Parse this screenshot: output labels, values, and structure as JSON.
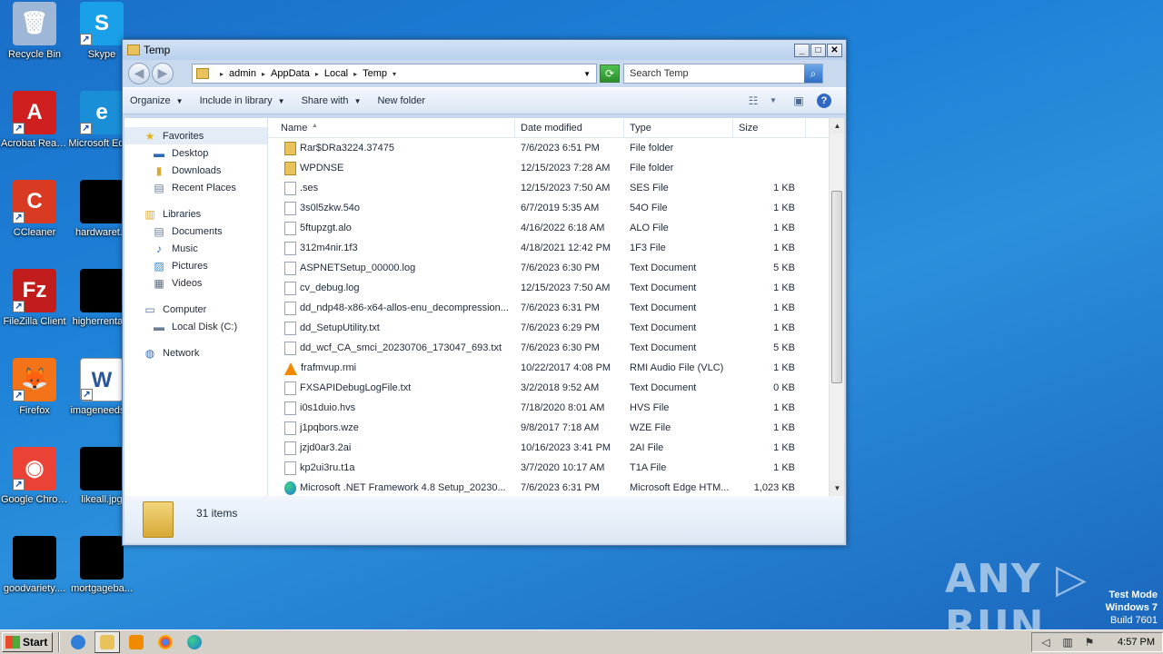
{
  "desktop": {
    "icons": [
      {
        "label": "Recycle Bin",
        "color": "#9fb7d6",
        "glyph": "🗑"
      },
      {
        "label": "Skype",
        "color": "#1aa0e8",
        "glyph": "S"
      },
      {
        "label": "Acrobat Reader DC",
        "color": "#cf1f1f",
        "glyph": "A"
      },
      {
        "label": "Microsoft Edge",
        "color": "#1a8fd8",
        "glyph": "e"
      },
      {
        "label": "CCleaner",
        "color": "#d93a22",
        "glyph": "C"
      },
      {
        "label": "hardwaret...",
        "color": "",
        "glyph": ""
      },
      {
        "label": "FileZilla Client",
        "color": "#c11d1d",
        "glyph": "Fz"
      },
      {
        "label": "higherrenta...",
        "color": "",
        "glyph": ""
      },
      {
        "label": "Firefox",
        "color": "#f27318",
        "glyph": "🦊"
      },
      {
        "label": "imageneeds...",
        "color": "#ffffff",
        "glyph": "W"
      },
      {
        "label": "Google Chrome",
        "color": "#ea4335",
        "glyph": "◉"
      },
      {
        "label": "likeall.jpg",
        "color": "",
        "glyph": ""
      },
      {
        "label": "goodvariety....",
        "color": "",
        "glyph": ""
      },
      {
        "label": "mortgageba...",
        "color": "",
        "glyph": ""
      }
    ]
  },
  "window": {
    "title": "Temp",
    "caption": {
      "min": "_",
      "max": "□",
      "close": "✕"
    },
    "address": {
      "crumbs": [
        "admin",
        "AppData",
        "Local",
        "Temp"
      ],
      "sep": "▸"
    },
    "search": {
      "placeholder": "Search Temp"
    },
    "toolbar": {
      "organize": "Organize",
      "include": "Include in library",
      "share": "Share with",
      "newfolder": "New folder"
    },
    "nav": {
      "favorites": "Favorites",
      "desktop": "Desktop",
      "downloads": "Downloads",
      "recent": "Recent Places",
      "libraries": "Libraries",
      "documents": "Documents",
      "music": "Music",
      "pictures": "Pictures",
      "videos": "Videos",
      "computer": "Computer",
      "localdisk": "Local Disk (C:)",
      "network": "Network"
    },
    "columns": {
      "name": "Name",
      "date": "Date modified",
      "type": "Type",
      "size": "Size"
    },
    "files": [
      {
        "name": "Rar$DRa3224.37475",
        "date": "7/6/2023 6:51 PM",
        "type": "File folder",
        "size": "",
        "icon": "folder"
      },
      {
        "name": "WPDNSE",
        "date": "12/15/2023 7:28 AM",
        "type": "File folder",
        "size": "",
        "icon": "folder"
      },
      {
        "name": ".ses",
        "date": "12/15/2023 7:50 AM",
        "type": "SES File",
        "size": "1 KB",
        "icon": "file"
      },
      {
        "name": "3s0l5zkw.54o",
        "date": "6/7/2019 5:35 AM",
        "type": "54O File",
        "size": "1 KB",
        "icon": "file"
      },
      {
        "name": "5ftupzgt.alo",
        "date": "4/16/2022 6:18 AM",
        "type": "ALO File",
        "size": "1 KB",
        "icon": "file"
      },
      {
        "name": "312m4nir.1f3",
        "date": "4/18/2021 12:42 PM",
        "type": "1F3 File",
        "size": "1 KB",
        "icon": "file"
      },
      {
        "name": "ASPNETSetup_00000.log",
        "date": "7/6/2023 6:30 PM",
        "type": "Text Document",
        "size": "5 KB",
        "icon": "file"
      },
      {
        "name": "cv_debug.log",
        "date": "12/15/2023 7:50 AM",
        "type": "Text Document",
        "size": "1 KB",
        "icon": "file"
      },
      {
        "name": "dd_ndp48-x86-x64-allos-enu_decompression...",
        "date": "7/6/2023 6:31 PM",
        "type": "Text Document",
        "size": "1 KB",
        "icon": "file"
      },
      {
        "name": "dd_SetupUtility.txt",
        "date": "7/6/2023 6:29 PM",
        "type": "Text Document",
        "size": "1 KB",
        "icon": "file"
      },
      {
        "name": "dd_wcf_CA_smci_20230706_173047_693.txt",
        "date": "7/6/2023 6:30 PM",
        "type": "Text Document",
        "size": "5 KB",
        "icon": "file"
      },
      {
        "name": "frafmvup.rmi",
        "date": "10/22/2017 4:08 PM",
        "type": "RMI Audio File (VLC)",
        "size": "1 KB",
        "icon": "vlc"
      },
      {
        "name": "FXSAPIDebugLogFile.txt",
        "date": "3/2/2018 9:52 AM",
        "type": "Text Document",
        "size": "0 KB",
        "icon": "file"
      },
      {
        "name": "i0s1duio.hvs",
        "date": "7/18/2020 8:01 AM",
        "type": "HVS File",
        "size": "1 KB",
        "icon": "file"
      },
      {
        "name": "j1pqbors.wze",
        "date": "9/8/2017 7:18 AM",
        "type": "WZE File",
        "size": "1 KB",
        "icon": "file"
      },
      {
        "name": "jzjd0ar3.2ai",
        "date": "10/16/2023 3:41 PM",
        "type": "2AI File",
        "size": "1 KB",
        "icon": "file"
      },
      {
        "name": "kp2ui3ru.t1a",
        "date": "3/7/2020 10:17 AM",
        "type": "T1A File",
        "size": "1 KB",
        "icon": "file"
      },
      {
        "name": "Microsoft .NET Framework 4.8 Setup_20230...",
        "date": "7/6/2023 6:31 PM",
        "type": "Microsoft Edge HTM...",
        "size": "1,023 KB",
        "icon": "edge"
      }
    ],
    "details": {
      "count": "31 items"
    }
  },
  "watermark": {
    "text": "ANY ▷ RUN"
  },
  "testmode": {
    "line1": "Test Mode",
    "line2": "Windows 7",
    "line3": "Build 7601"
  },
  "taskbar": {
    "start": "Start",
    "clock": "4:57 PM"
  }
}
